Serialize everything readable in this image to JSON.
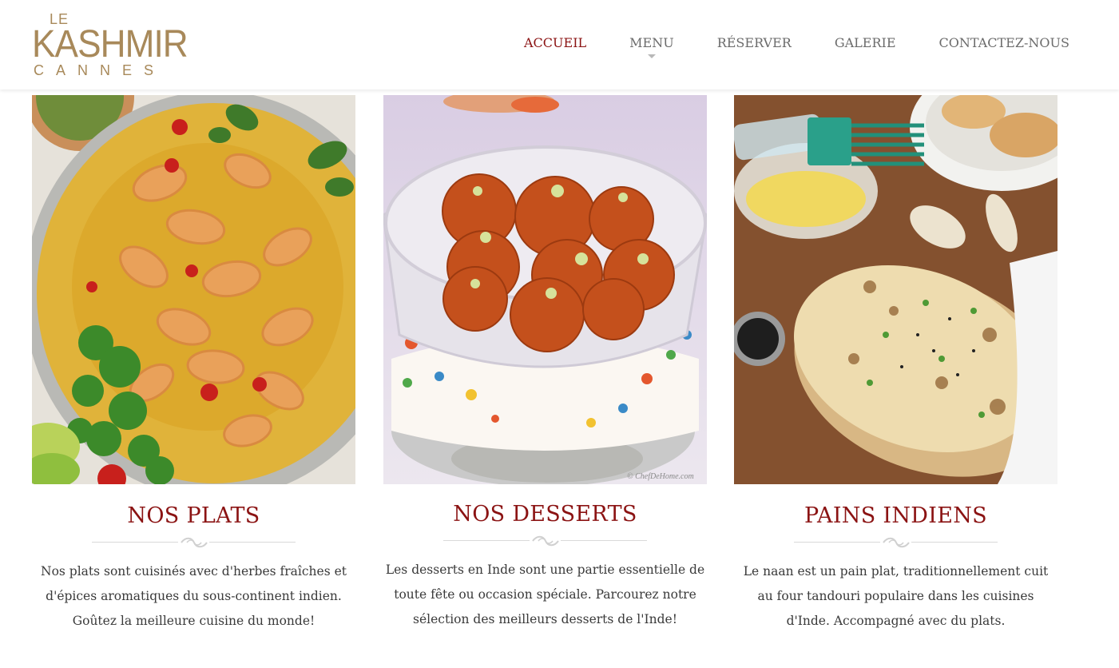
{
  "brand": {
    "logo_top": "LE",
    "logo_main": "KASHMIR",
    "logo_sub": "CANNES",
    "color": "#a8895a"
  },
  "nav": {
    "items": [
      {
        "label": "ACCUEIL",
        "active": true
      },
      {
        "label": "MENU",
        "has_dropdown": true
      },
      {
        "label": "RÉSERVER"
      },
      {
        "label": "GALERIE"
      },
      {
        "label": "CONTACTEZ-NOUS"
      }
    ],
    "active_color": "#8b1313"
  },
  "cards": [
    {
      "title": "NOS PLATS",
      "image": "shrimp-curry-photo",
      "text_lines": [
        "Nos plats sont cuisinés avec d'herbes fraîches et",
        "d'épices aromatiques du sous-continent indien.",
        "Goûtez la meilleure cuisine du monde!"
      ]
    },
    {
      "title": "NOS DESSERTS",
      "image": "gulab-jamun-photo",
      "watermark": "© ChefDeHome.com",
      "text_lines": [
        "Les desserts en Inde sont une partie essentielle de",
        "toute fête ou occasion spéciale. Parcourez notre",
        "sélection des meilleurs desserts de l'Inde!"
      ]
    },
    {
      "title": "PAINS INDIENS",
      "image": "naan-bread-photo",
      "text_lines": [
        "Le naan est un pain plat, traditionnellement cuit",
        "au four tandouri populaire dans les cuisines",
        "d'Inde. Accompagné avec du plats."
      ]
    }
  ],
  "colors": {
    "title": "#8b1313",
    "body_text": "#3a3a3a"
  }
}
